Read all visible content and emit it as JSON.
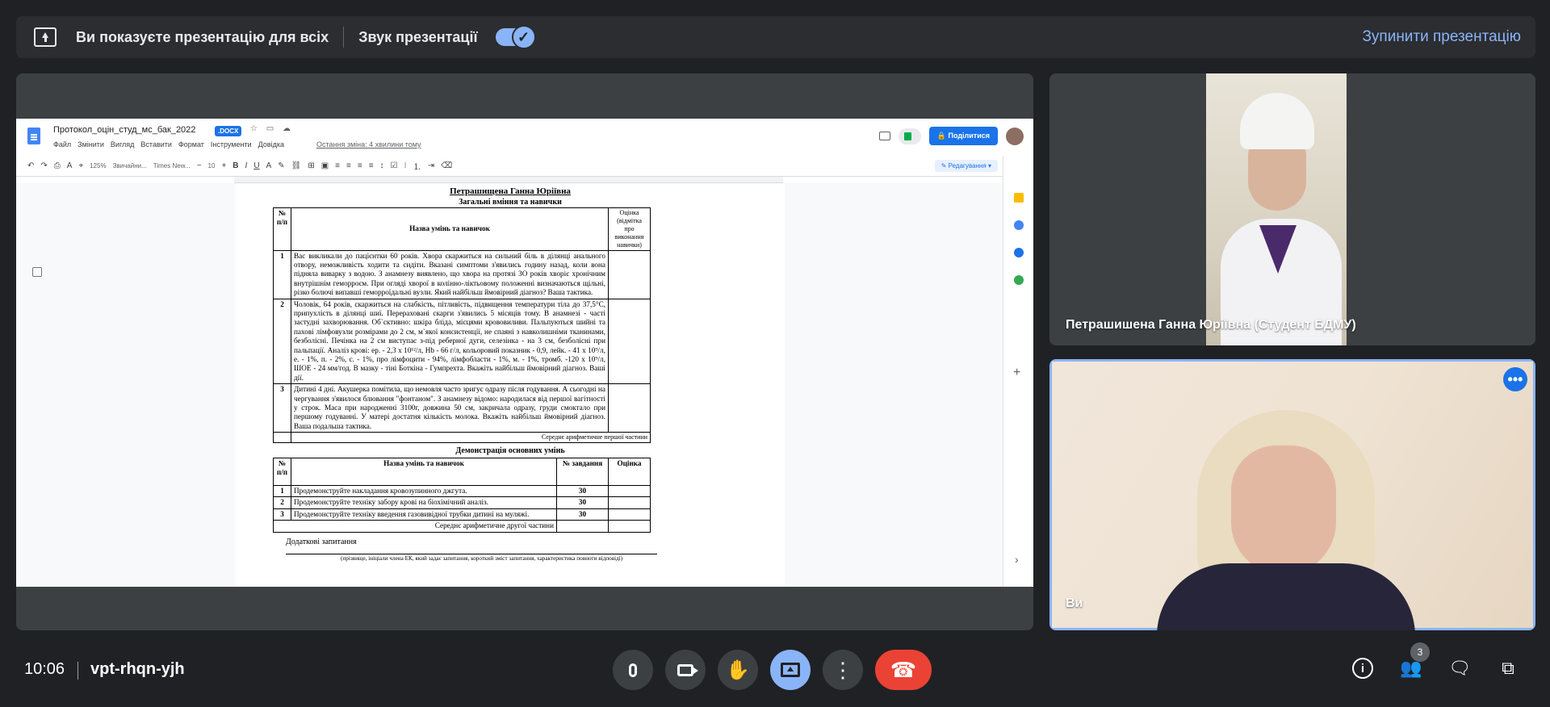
{
  "banner": {
    "message": "Ви показуєте презентацію для всіх",
    "sound_label": "Звук презентації",
    "stop_label": "Зупинити презентацію"
  },
  "doc": {
    "filename": "Протокол_оцін_студ_мс_бак_2022",
    "badge": ".DOCX",
    "menus": [
      "Файл",
      "Змінити",
      "Вигляд",
      "Вставити",
      "Формат",
      "Інструменти",
      "Довідка"
    ],
    "last_edit": "Остання зміна: 4 хвилини тому",
    "share_label": "Поділитися",
    "zoom": "125%",
    "style": "Звичайни...",
    "font": "Times New...",
    "font_size": "10",
    "edit_mode": "Редагування",
    "student_name": "Петрашищена Ганна Юріївна",
    "section1_title": "Загальні вміння та навички",
    "table1": {
      "headers": [
        "№ п/п",
        "Назва умінь та навичок",
        "Оцінка (відмітка про виконання навички)"
      ],
      "rows": [
        {
          "num": "1",
          "text": "Вас викликали до пацієнтки 60 років. Хвора скаржиться на сильний біль в ділянці анального отвору, неможливість ходити та сидіти. Вказані симптоми з'явились годину назад, коли вона підняла виварку з водою. З анамнезу виявлено, що хвора на протязі 3О років хворіє хронічним внутрішнім геморроєм. При огляді хворої в колінно-ліктьовому положенні визначаються щільні, різко болючі випавші геморроїдальні вузли. Який найбільш ймовірний діагноз? Ваша тактика."
        },
        {
          "num": "2",
          "text": "Чоловік, 64 років, скаржиться на слабкість, пітливість, підвищення температури тіла до 37,5°С, припухлість в ділянці шиї. Перераховані скарги з'явились 5 місяців тому. В анамнезі - часті застудні захворювання. Об`єктивно: шкіра бліда, місцями крововиливи. Пальпуються шийні та пахові лімфовузли розмірами до 2 см, м`якої консистенції, не спаяні з навколишніми тканинами, безболісні. Печінка на 2 см виступає з-під реберної дуги, селезінка - на 3 см, безболісні при пальпації. Аналіз крові: ер. - 2,3 х 10¹²/л, Hb - 66 г/л, кольоровий показник - 0,9, лейк. - 41 х 10⁹/л, е. - 1%, п. - 2%, с. - 1%, про лімфоцити - 94%, лімфобласти - 1%, м. - 1%, тромб. -120 х 10⁹/л, ШОЕ - 24 мм/год. В мазку - тіні Боткіна - Гумпрехта. Вкажіть найбільш ймовірний діагноз. Ваші дії."
        },
        {
          "num": "3",
          "text": "Дитині 4 дні. Акушерка помітила, що немовля часто зригує одразу після годування. А сьогодні на чергування з'явилося блювання \"фонтаном\". З анамнезу відомо: народилася від першої вагітності у строк. Маса при народженні 3100г, довжина 50 см, закричала одразу, груди смоктало при першому годуванні. У матері достатня кількість молока. Вкажіть найбільш ймовірний діагноз. Ваша подальша тактика."
        }
      ],
      "footer": "Середнє арифметичне першої частини"
    },
    "section2_title": "Демонстрація основних умінь",
    "table2": {
      "headers": [
        "№ п/п",
        "Назва умінь та навичок",
        "№ завдання",
        "Оцінка"
      ],
      "rows": [
        {
          "num": "1",
          "text": "Продемонструйте накладання кровозупинного джгута.",
          "task": "30"
        },
        {
          "num": "2",
          "text": "Продемонструйте техніку забору крові на біохімічний аналіз.",
          "task": "30"
        },
        {
          "num": "3",
          "text": "Продемонструйте техніку введення газовивідної трубки дитині на муляжі.",
          "task": "30"
        }
      ],
      "footer": "Середнє арифметичне другої частини"
    },
    "additional": "Додаткові запитання",
    "signature_note": "(прізвище, ініціали члена ЕК, який задає запитання, короткий зміст запитання, характеристика повноти відповіді)"
  },
  "participants": {
    "tile1_name": "Петрашишена Ганна Юріївна (Студент БДМУ)",
    "tile2_name": "Ви"
  },
  "bottom": {
    "time": "10:06",
    "meeting_code": "vpt-rhqn-yjh",
    "participant_count": "3"
  },
  "colors": {
    "accent": "#8ab4f8",
    "hangup": "#ea4335",
    "docs_blue": "#1a73e8"
  }
}
